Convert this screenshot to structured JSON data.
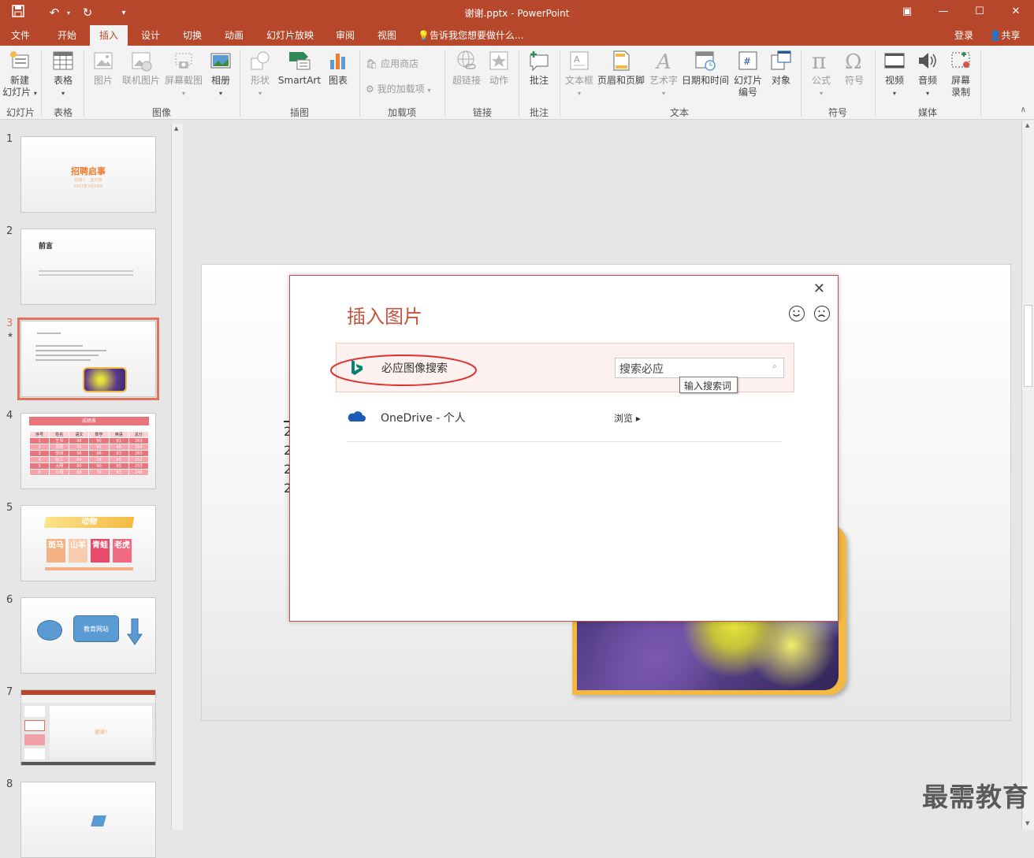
{
  "window": {
    "title": "谢谢.pptx - PowerPoint",
    "qat_icons": [
      "save-icon",
      "undo-icon",
      "undo-dropdown-icon",
      "redo-icon",
      "customize-qat-icon"
    ],
    "win_buttons": [
      "ribbon-display-icon",
      "minimize-icon",
      "maximize-icon",
      "close-icon"
    ]
  },
  "tabs": [
    "文件",
    "开始",
    "插入",
    "设计",
    "切换",
    "动画",
    "幻灯片放映",
    "审阅",
    "视图"
  ],
  "active_tab": "插入",
  "tell_me": "告诉我您想要做什么...",
  "account": {
    "login": "登录",
    "share": "共享"
  },
  "ribbon": {
    "slides": {
      "new_slide": "新建",
      "new_slide_2": "幻灯片",
      "group": "幻灯片"
    },
    "tables": {
      "table": "表格",
      "group": "表格"
    },
    "images": {
      "picture": "图片",
      "online_picture": "联机图片",
      "screenshot": "屏幕截图",
      "album": "相册",
      "group": "图像"
    },
    "illustrations": {
      "shapes": "形状",
      "smartart": "SmartArt",
      "chart": "图表",
      "group": "插图"
    },
    "addins": {
      "store": "应用商店",
      "my_addins": "我的加载项",
      "group": "加载项"
    },
    "links": {
      "hyperlink": "超链接",
      "action": "动作",
      "group": "链接"
    },
    "comments": {
      "comment": "批注",
      "group": "批注"
    },
    "text": {
      "textbox": "文本框",
      "header_footer": "页眉和页脚",
      "wordart": "艺术字",
      "datetime": "日期和时间",
      "slide_number": "幻灯片",
      "slide_number_2": "编号",
      "object": "对象",
      "group": "文本"
    },
    "symbols": {
      "equation": "公式",
      "symbol": "符号",
      "group": "符号"
    },
    "media": {
      "video": "视频",
      "audio": "音频",
      "screen_record": "屏幕",
      "screen_record_2": "录制",
      "group": "媒体"
    }
  },
  "thumbnails": [
    {
      "num": "1",
      "title": "招聘启事",
      "line1": "招聘人：蓝天楼",
      "line2": "2017年7月19日"
    },
    {
      "num": "2",
      "title": "前言"
    },
    {
      "num": "3",
      "selected": true,
      "star": "★"
    },
    {
      "num": "4",
      "title": "成绩表",
      "headers": [
        "序号",
        "姓名",
        "语文",
        "数学",
        "英语",
        "总分"
      ],
      "rows": [
        [
          "1",
          "王书",
          "98",
          "90",
          "81",
          "269"
        ],
        [
          "2",
          "周周",
          "95",
          "85",
          "88",
          "268"
        ],
        [
          "3",
          "李四",
          "98",
          "86",
          "83",
          "265"
        ],
        [
          "4",
          "张三",
          "89",
          "78",
          "85",
          "252"
        ],
        [
          "5",
          "大明",
          "80",
          "90",
          "85",
          "255"
        ],
        [
          "6",
          "小杨",
          "88",
          "79",
          "82",
          "249"
        ]
      ]
    },
    {
      "num": "5",
      "title": "动物",
      "cells": [
        "斑马",
        "山羊",
        "青蛙",
        "老虎"
      ]
    },
    {
      "num": "6",
      "label": "教育网站"
    },
    {
      "num": "7",
      "text": "谢谢!"
    },
    {
      "num": "8"
    }
  ],
  "dialog": {
    "title": "插入图片",
    "close": "✕",
    "bing_label": "必应图像搜索",
    "search_placeholder": "搜索必应",
    "tooltip": "输入搜索词",
    "onedrive_label": "OneDrive - 个人",
    "browse": "浏览 ▸"
  },
  "watermark": "最需教育",
  "colors": {
    "accent": "#b7472a",
    "dialog_title": "#c9533e",
    "selection": "#e2725b",
    "bing": "#008373",
    "onedrive": "#1e5cb3"
  }
}
